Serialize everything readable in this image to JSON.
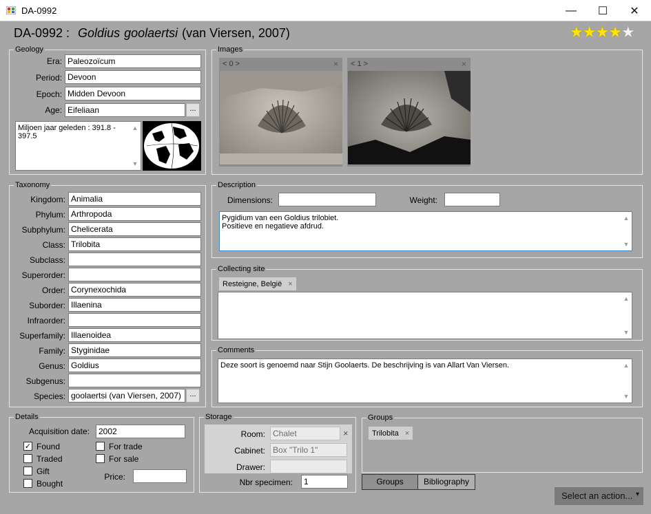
{
  "window": {
    "title": "DA-0992",
    "minimize": "—",
    "maximize": "☐",
    "close": "✕"
  },
  "header": {
    "code": "DA-0992 :",
    "genus": "Goldius",
    "species": "goolaertsi",
    "author": "(van Viersen, 2007)",
    "rating": 4,
    "rating_max": 5
  },
  "geology": {
    "label": "Geology",
    "era": {
      "label": "Era:",
      "value": "Paleozoïcum"
    },
    "period": {
      "label": "Period:",
      "value": "Devoon"
    },
    "epoch": {
      "label": "Epoch:",
      "value": "Midden Devoon"
    },
    "age": {
      "label": "Age:",
      "value": "Eifeliaan"
    },
    "ellipsis": "...",
    "mya_text": "Miljoen jaar geleden : 391.8 - 397.5"
  },
  "images": {
    "label": "Images",
    "nav": "< 0 >",
    "nav2": "< 1 >",
    "close": "×"
  },
  "taxonomy": {
    "label": "Taxonomy",
    "rows": [
      {
        "label": "Kingdom:",
        "value": "Animalia"
      },
      {
        "label": "Phylum:",
        "value": "Arthropoda"
      },
      {
        "label": "Subphylum:",
        "value": "Chelicerata"
      },
      {
        "label": "Class:",
        "value": "Trilobita"
      },
      {
        "label": "Subclass:",
        "value": ""
      },
      {
        "label": "Superorder:",
        "value": ""
      },
      {
        "label": "Order:",
        "value": "Corynexochida"
      },
      {
        "label": "Suborder:",
        "value": "Illaenina"
      },
      {
        "label": "Infraorder:",
        "value": ""
      },
      {
        "label": "Superfamily:",
        "value": "Illaenoidea"
      },
      {
        "label": "Family:",
        "value": "Styginidae"
      },
      {
        "label": "Genus:",
        "value": "Goldius"
      },
      {
        "label": "Subgenus:",
        "value": ""
      },
      {
        "label": "Species:",
        "value": "goolaertsi (van Viersen, 2007)"
      }
    ],
    "ellipsis": "..."
  },
  "description": {
    "label": "Description",
    "dimensions_label": "Dimensions:",
    "dimensions": "",
    "weight_label": "Weight:",
    "weight": "",
    "line1": "Pygidium van een Goldius trilobiet.",
    "line2": "Positieve en negatieve afdrud."
  },
  "collecting_site": {
    "label": "Collecting site",
    "chip": "Resteigne, België",
    "chip_x": "×"
  },
  "comments": {
    "label": "Comments",
    "text": "Deze soort is genoemd naar Stijn Goolaerts. De beschrijving is van Allart Van Viersen."
  },
  "details": {
    "label": "Details",
    "acq_label": "Acquisition date:",
    "acq_value": "2002",
    "found": "Found",
    "traded": "Traded",
    "gift": "Gift",
    "bought": "Bought",
    "for_trade": "For trade",
    "for_sale": "For sale",
    "price_label": "Price:",
    "price_value": "",
    "check": "✓"
  },
  "storage": {
    "label": "Storage",
    "room_label": "Room:",
    "room": "Chalet",
    "room_x": "×",
    "cabinet_label": "Cabinet:",
    "cabinet": "Box \"Trilo 1\"",
    "drawer_label": "Drawer:",
    "drawer": "",
    "nbr_label": "Nbr specimen:",
    "nbr": "1"
  },
  "groups": {
    "label": "Groups",
    "chip": "Trilobita",
    "chip_x": "×",
    "tab_groups": "Groups",
    "tab_biblio": "Bibliography"
  },
  "action": {
    "label": "Select an action...",
    "caret": "▾"
  }
}
